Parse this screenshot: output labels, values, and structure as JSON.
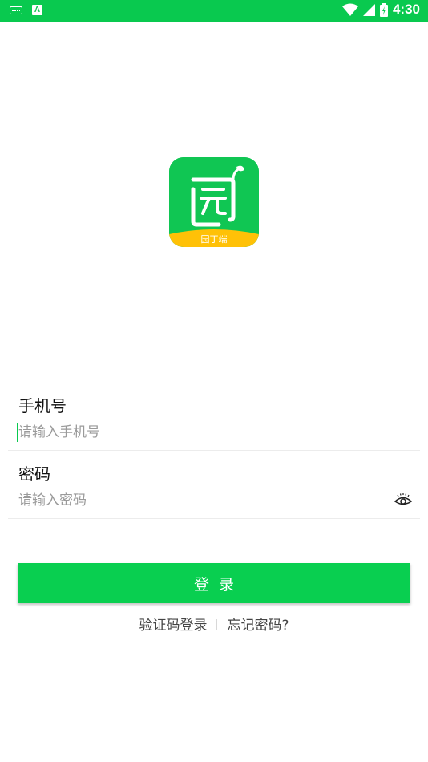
{
  "status_bar": {
    "time": "4:30",
    "left_icons": [
      "keyboard-icon",
      "a-notification-icon"
    ],
    "right_icons": [
      "wifi-icon",
      "cell-signal-icon",
      "battery-icon"
    ],
    "a_icon_text": "A",
    "background": "#09c94f"
  },
  "logo": {
    "banner_text": "园丁端",
    "bg_color": "#10c653",
    "banner_color": "#ffc107"
  },
  "phone": {
    "label": "手机号",
    "placeholder": "请输入手机号"
  },
  "password": {
    "label": "密码",
    "placeholder": "请输入密码",
    "toggle_icon": "eye-icon"
  },
  "login_button": {
    "label": "登录",
    "color": "#09cf50"
  },
  "links": {
    "sms_login": "验证码登录",
    "forgot_password": "忘记密码?"
  }
}
